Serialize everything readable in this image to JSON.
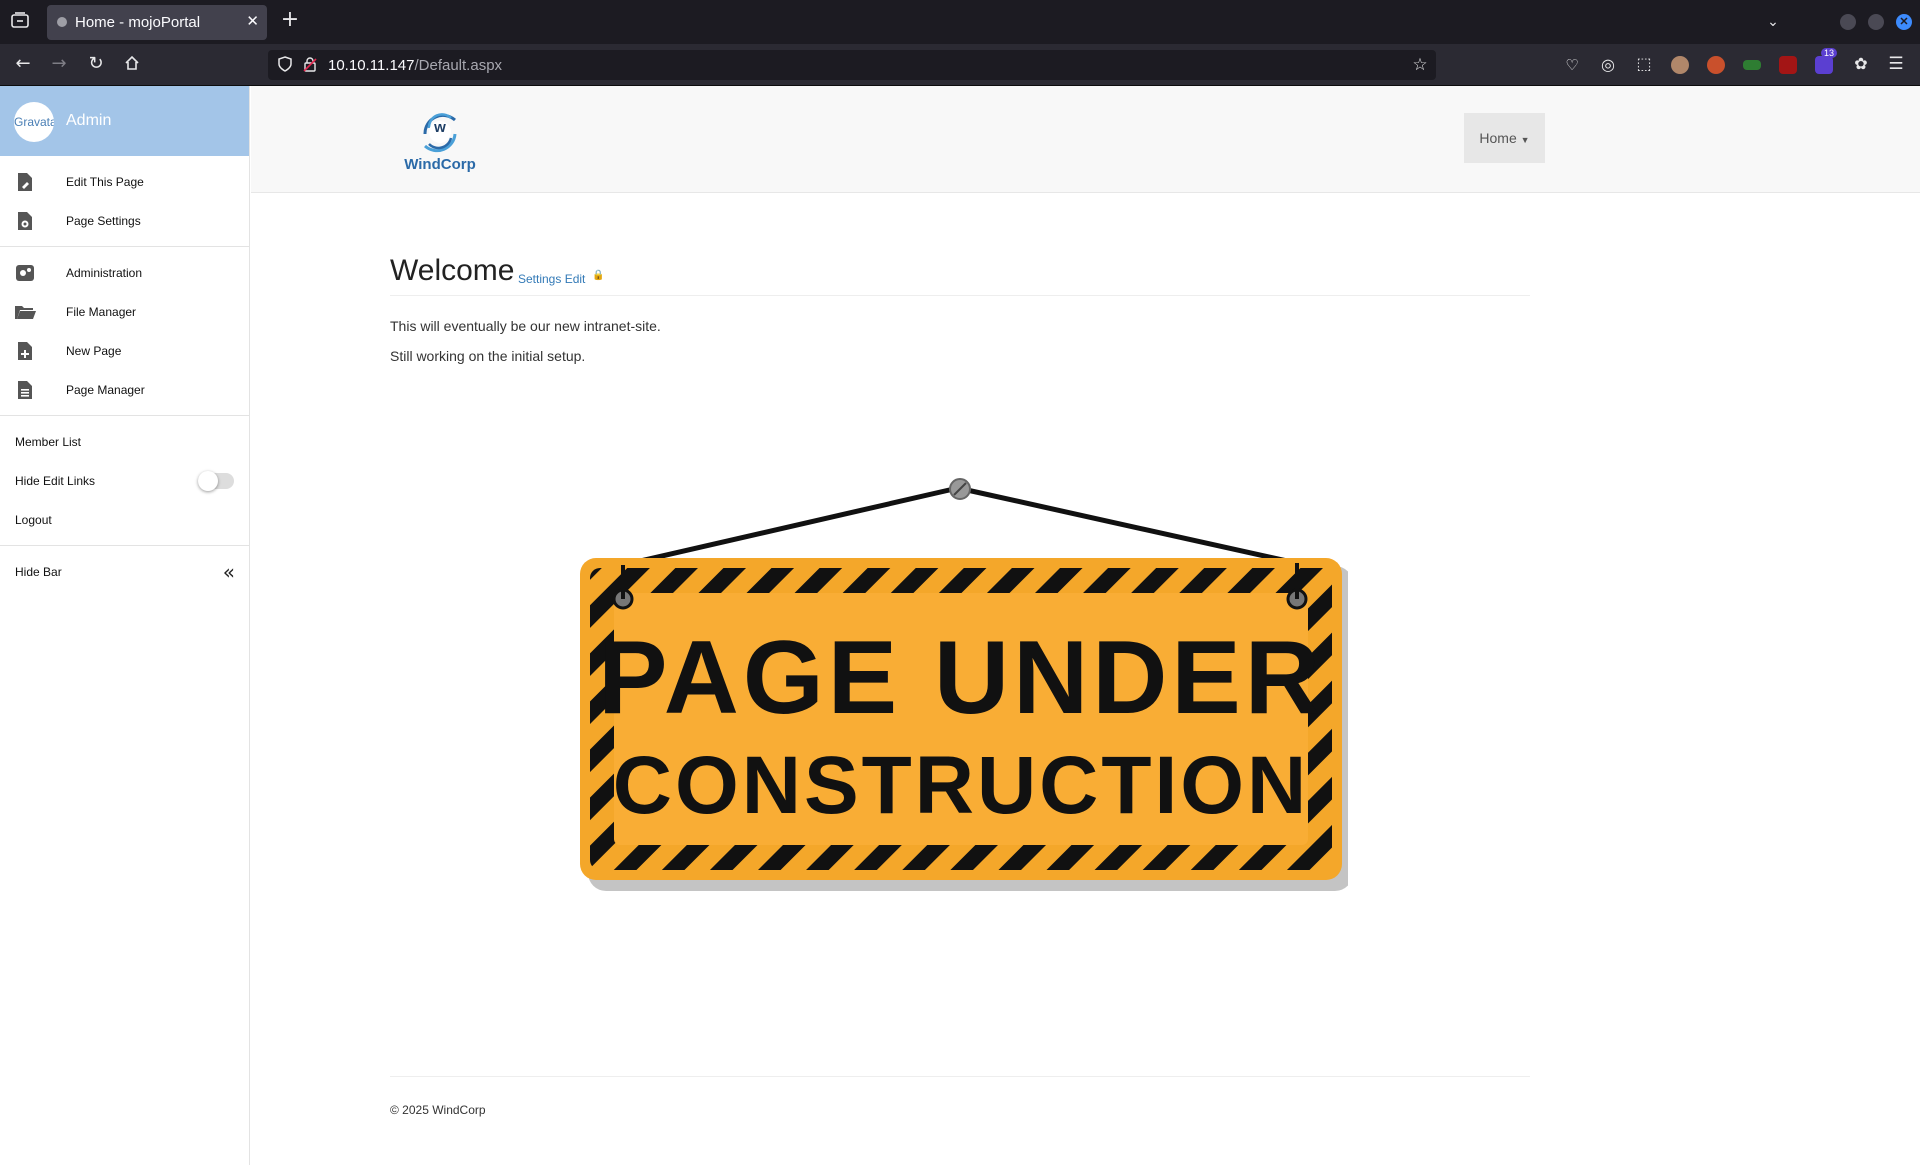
{
  "browser": {
    "tab_title": "Home - mojoPortal",
    "url_host": "10.10.11.147",
    "url_path": "/Default.aspx",
    "extension_badge": "13"
  },
  "admin_bar": {
    "avatar_text": "Gravatar",
    "user_name": "Admin",
    "items": [
      {
        "label": "Edit This Page",
        "icon": "edit-page-icon"
      },
      {
        "label": "Page Settings",
        "icon": "page-settings-icon"
      },
      {
        "label": "Administration",
        "icon": "administration-icon"
      },
      {
        "label": "File Manager",
        "icon": "folder-icon"
      },
      {
        "label": "New Page",
        "icon": "new-page-icon"
      },
      {
        "label": "Page Manager",
        "icon": "page-manager-icon"
      }
    ],
    "member_list": "Member List",
    "hide_edit_links": "Hide Edit Links",
    "hide_edit_links_on": false,
    "logout": "Logout",
    "hide_bar": "Hide Bar"
  },
  "site": {
    "logo_text": "WindCorp",
    "logo_letter": "w",
    "nav_home": "Home"
  },
  "main": {
    "title": "Welcome",
    "settings_link": "Settings",
    "edit_link": "Edit",
    "paragraphs": [
      "This will eventually be our new intranet-site.",
      "Still working on the initial setup."
    ],
    "sign_line1": "PAGE UNDER",
    "sign_line2": "CONSTRUCTION"
  },
  "footer": {
    "copyright": "© 2025 WindCorp"
  }
}
